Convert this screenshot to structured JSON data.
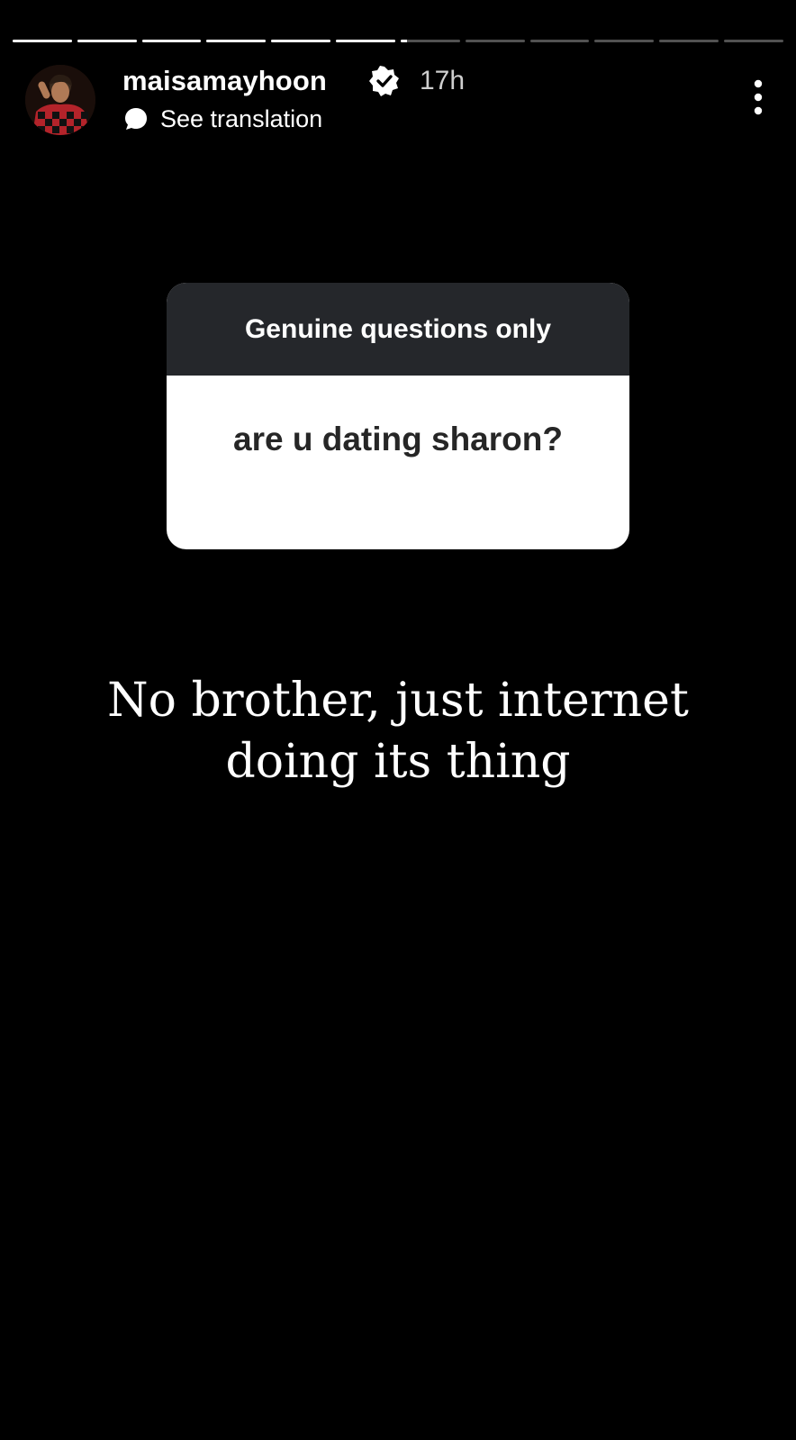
{
  "story": {
    "progress": {
      "segment_count": 12,
      "completed_segments": 6,
      "current_fill_fraction": 0.1
    },
    "header": {
      "username": "maisamayhoon",
      "time_ago": "17h",
      "translate_label": "See translation",
      "icons": {
        "avatar": "profile-photo",
        "verified": "verified-badge-icon",
        "translate": "speech-bubble-icon",
        "more": "more-options-icon"
      }
    },
    "question_sticker": {
      "prompt": "Genuine questions only",
      "question": "are u dating sharon?"
    },
    "reply_text": {
      "line1": "No brother, just internet",
      "line2": "doing its thing"
    },
    "colors": {
      "background": "#000000",
      "sticker_header": "#25272b",
      "sticker_body": "#ffffff",
      "question_text": "#262626"
    }
  }
}
